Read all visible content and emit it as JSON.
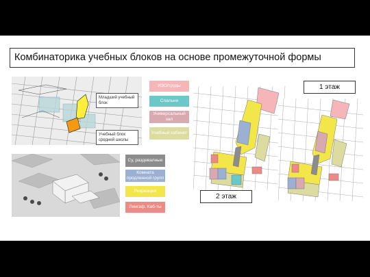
{
  "title": "Комбинаторика учебных блоков на основе промежуточной формы",
  "model_labels": {
    "junior": "Младший учебный блок",
    "middle": "Учебный блок средней школы"
  },
  "legend_top": [
    {
      "label": "ИЗО/труды",
      "color": "#f6b5b8"
    },
    {
      "label": "Спальни",
      "color": "#6cc7c9"
    },
    {
      "label": "Универсальный зал",
      "color": "#d8a9b0"
    },
    {
      "label": "Учебный кабинет",
      "color": "#dcdca0"
    }
  ],
  "legend_bottom": [
    {
      "label": "Су, раздевалные",
      "color": "#8c8c8c"
    },
    {
      "label": "Комната продленной групп",
      "color": "#9bb0d3"
    },
    {
      "label": "Рекреация",
      "color": "#f2e64a"
    },
    {
      "label": "Лингаф. Каб-ты",
      "color": "#ee8a86"
    }
  ],
  "floor_labels": {
    "first": "1 этаж",
    "second": "2 этаж"
  }
}
